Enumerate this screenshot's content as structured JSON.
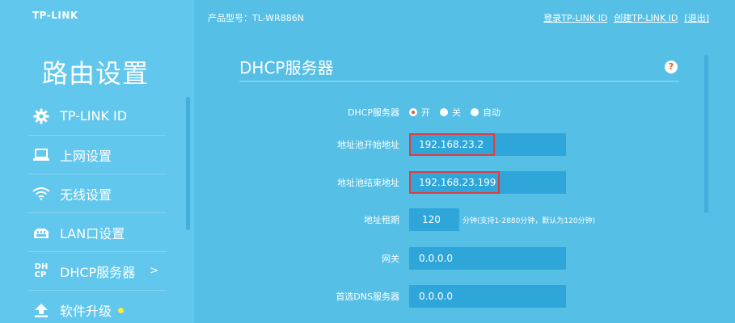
{
  "brand": {
    "logo": "TP-LINK"
  },
  "header": {
    "model": "产品型号：TL-WR886N",
    "links": [
      "登录TP-LINK ID",
      "创建TP-LINK ID",
      "[退出]"
    ]
  },
  "sidebar": {
    "title": "路由设置",
    "items": [
      {
        "label": "TP-LINK ID",
        "icon": "gear-icon"
      },
      {
        "label": "上网设置",
        "icon": "laptop-icon"
      },
      {
        "label": "无线设置",
        "icon": "wifi-icon"
      },
      {
        "label": "LAN口设置",
        "icon": "lan-icon"
      },
      {
        "label": "DHCP服务器",
        "icon": "dhcp-icon",
        "active": true,
        "chevron": ">"
      },
      {
        "label": "软件升级",
        "icon": "upload-icon",
        "badge_color": "#f7ed3b"
      }
    ]
  },
  "main": {
    "title": "DHCP服务器",
    "help": "?",
    "dhcp_server": {
      "label": "DHCP服务器",
      "options": [
        "开",
        "关",
        "自动"
      ],
      "selected": "开"
    },
    "start_ip": {
      "label": "地址池开始地址",
      "value": "192.168.23.2"
    },
    "end_ip": {
      "label": "地址池结束地址",
      "value": "192.168.23.199"
    },
    "lease": {
      "label": "地址租期",
      "value": "120",
      "suffix": "分钟(支持1-2880分钟，默认为120分钟)"
    },
    "gateway": {
      "label": "网关",
      "value": "0.0.0.0"
    },
    "dns": {
      "label": "首选DNS服务器",
      "value": "0.0.0.0"
    }
  },
  "colors": {
    "background": "#55bfe6",
    "sidebar": "#62c7ec",
    "input": "#2ea6da",
    "highlight": "#e53a3a",
    "accent": "#e05a2a"
  }
}
